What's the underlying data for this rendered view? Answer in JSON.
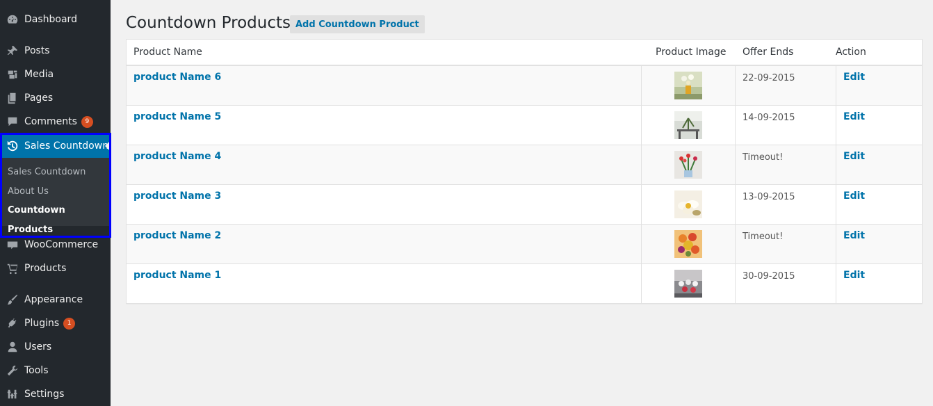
{
  "sidebar": {
    "items": [
      {
        "label": "Dashboard",
        "icon": "dashboard-icon"
      },
      {
        "label": "Posts",
        "icon": "pin-icon"
      },
      {
        "label": "Media",
        "icon": "media-icon"
      },
      {
        "label": "Pages",
        "icon": "pages-icon"
      },
      {
        "label": "Comments",
        "icon": "comment-icon",
        "badge": "9"
      },
      {
        "label": "Sales Countdown",
        "icon": "history-clock-icon"
      },
      {
        "label": "WooCommerce",
        "icon": "woo-icon"
      },
      {
        "label": "Products",
        "icon": "cart-icon"
      },
      {
        "label": "Appearance",
        "icon": "brush-icon"
      },
      {
        "label": "Plugins",
        "icon": "plug-icon",
        "badge": "1"
      },
      {
        "label": "Users",
        "icon": "user-icon"
      },
      {
        "label": "Tools",
        "icon": "wrench-icon"
      },
      {
        "label": "Settings",
        "icon": "sliders-icon"
      }
    ],
    "submenu": [
      "Sales Countdown",
      "About Us",
      "Countdown Products"
    ]
  },
  "page": {
    "title": "Countdown Products",
    "add_button": "Add Countdown Product"
  },
  "table": {
    "headers": [
      "Product Name",
      "Product Image",
      "Offer Ends",
      "Action"
    ],
    "rows": [
      {
        "name": "product Name 6",
        "offer_ends": "22-09-2015",
        "action": "Edit"
      },
      {
        "name": "product Name 5",
        "offer_ends": "14-09-2015",
        "action": "Edit"
      },
      {
        "name": "product Name 4",
        "offer_ends": "Timeout!",
        "action": "Edit"
      },
      {
        "name": "product Name 3",
        "offer_ends": "13-09-2015",
        "action": "Edit"
      },
      {
        "name": "product Name 2",
        "offer_ends": "Timeout!",
        "action": "Edit"
      },
      {
        "name": "product Name 1",
        "offer_ends": "30-09-2015",
        "action": "Edit"
      }
    ]
  },
  "colors": {
    "sidebar_bg": "#23282d",
    "accent": "#0073aa",
    "badge": "#d54e21",
    "highlight_border": "#0000ff"
  }
}
